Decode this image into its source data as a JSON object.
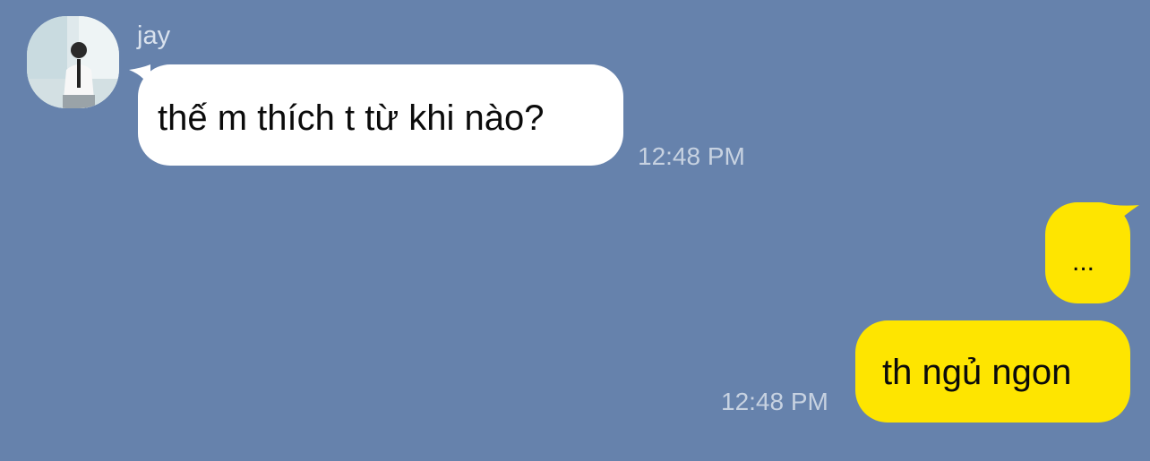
{
  "theme": {
    "background": "#6682ac",
    "incoming_bubble": "#ffffff",
    "outgoing_bubble": "#fee500",
    "timestamp_color": "#c7d2e1"
  },
  "contact": {
    "name": "jay",
    "avatar_icon": "profile-photo"
  },
  "messages": [
    {
      "direction": "incoming",
      "text": "thế m thích t từ khi nào?",
      "time": "12:48 PM"
    },
    {
      "direction": "outgoing",
      "text": "...",
      "time": ""
    },
    {
      "direction": "outgoing",
      "text": "th ngủ ngon",
      "time": "12:48 PM"
    }
  ]
}
